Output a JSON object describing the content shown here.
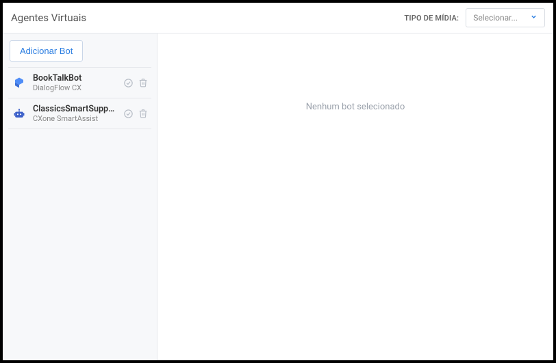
{
  "header": {
    "title": "Agentes Virtuais",
    "mediaLabel": "TIPO DE MÍDIA:",
    "selectPlaceholder": "Selecionar..."
  },
  "sidebar": {
    "addButton": "Adicionar Bot",
    "items": [
      {
        "name": "BookTalkBot",
        "provider": "DialogFlow CX",
        "icon": "dialogflow"
      },
      {
        "name": "ClassicsSmartSuppo...",
        "provider": "CXone SmartAssist",
        "icon": "cxone"
      }
    ]
  },
  "main": {
    "emptyState": "Nenhum bot selecionado"
  }
}
